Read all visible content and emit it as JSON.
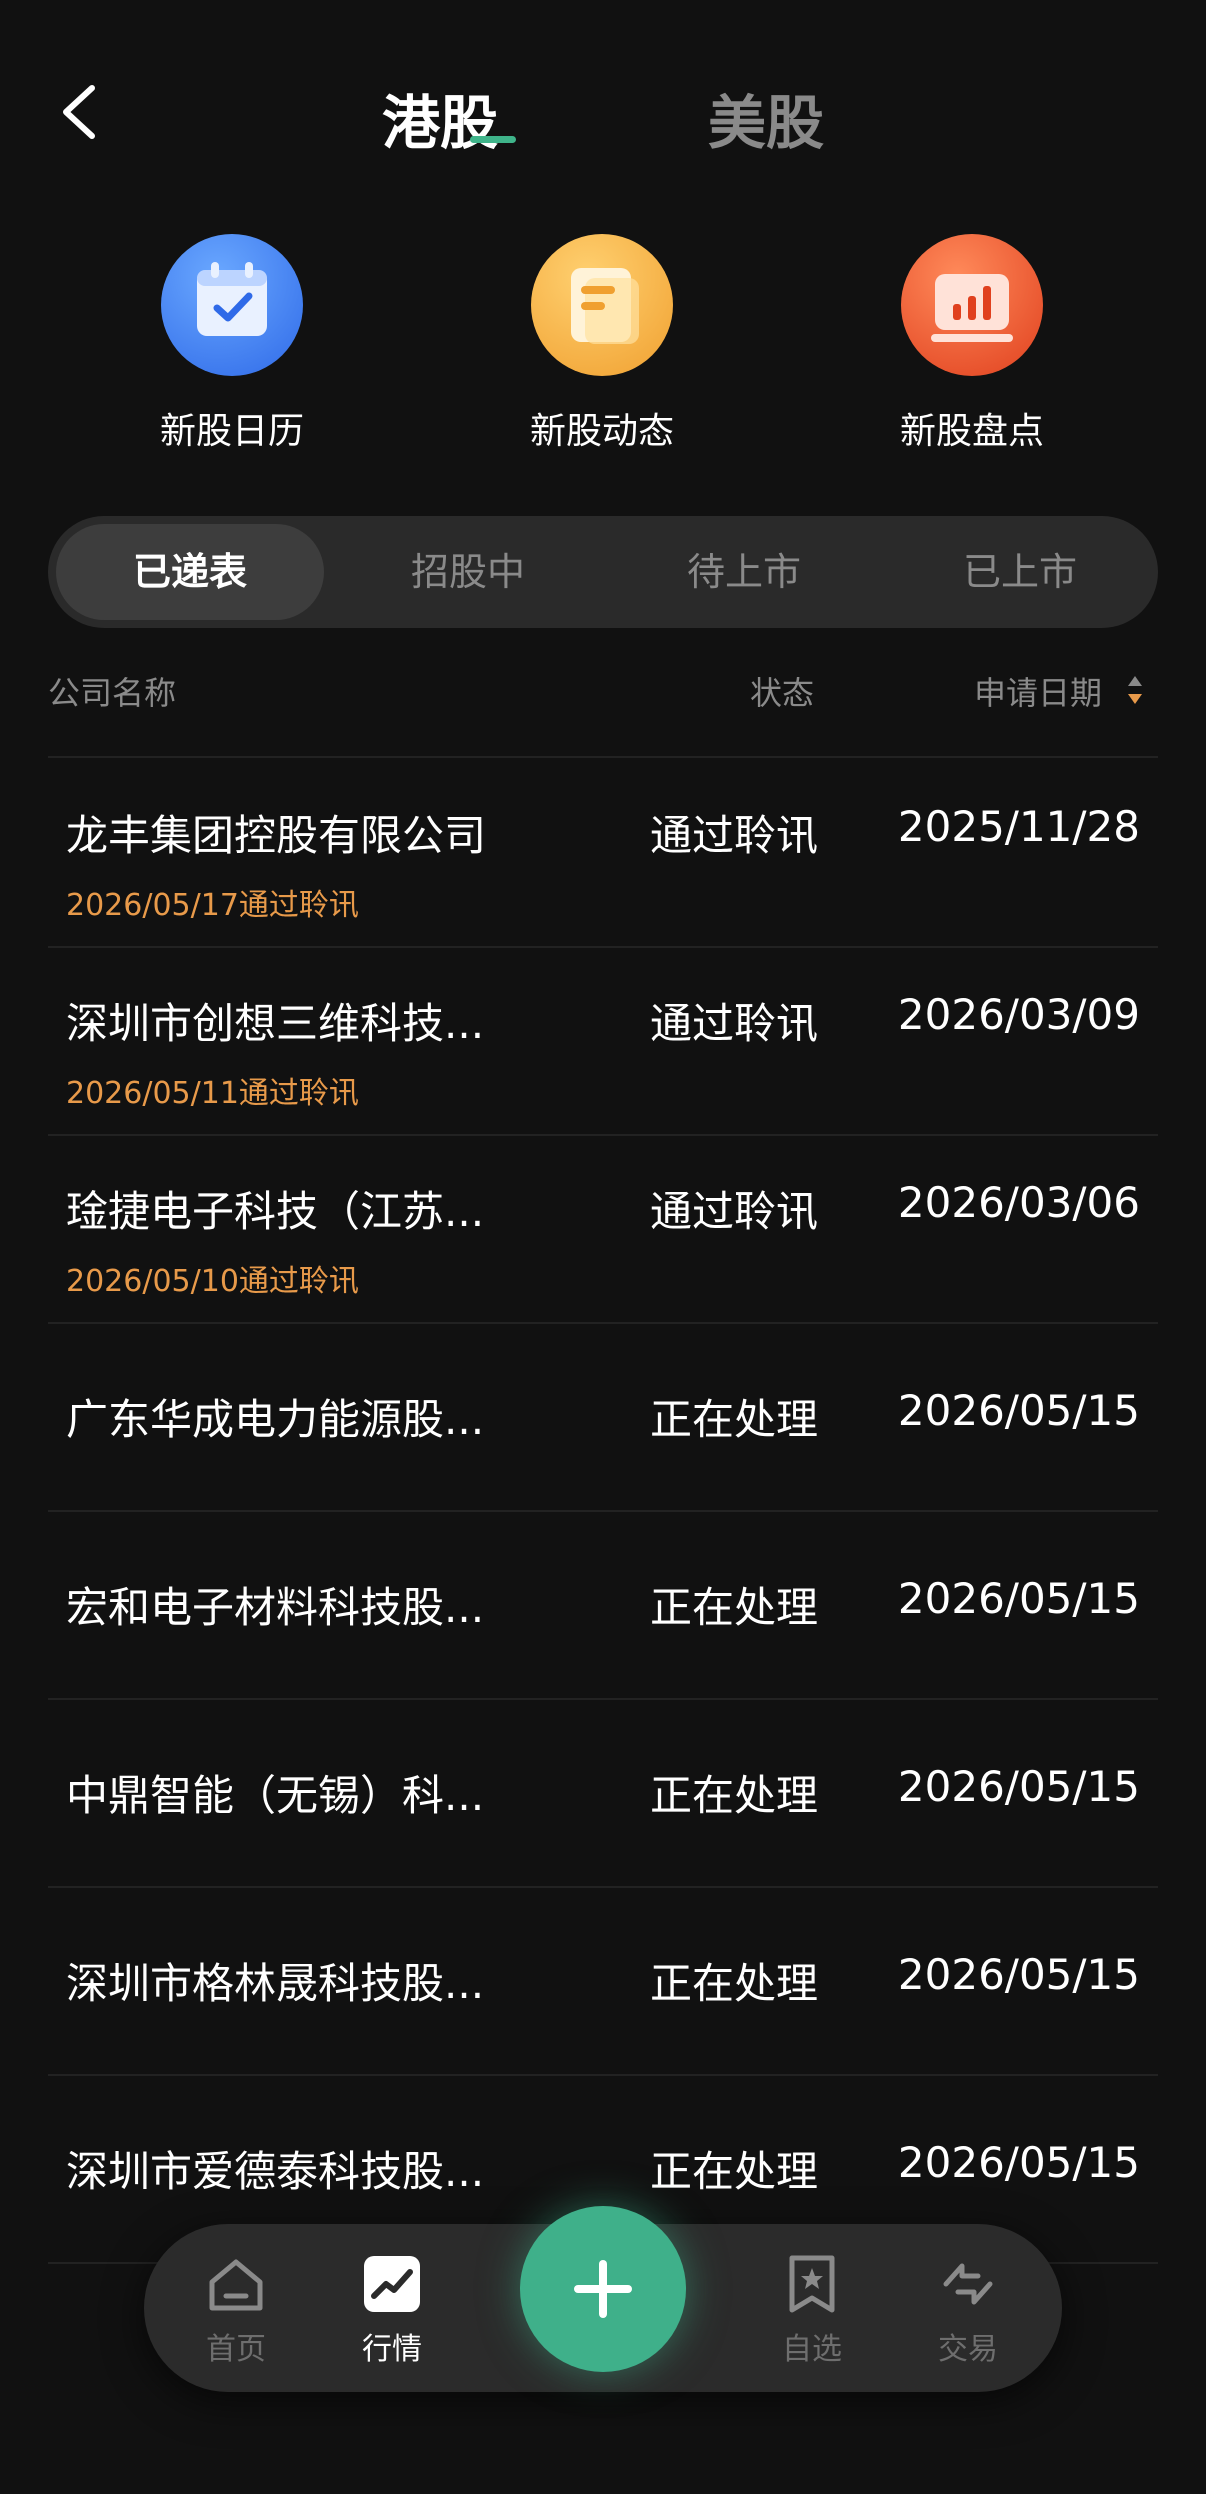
{
  "header": {
    "tabs": [
      {
        "label": "港股",
        "active": true
      },
      {
        "label": "美股",
        "active": false
      }
    ]
  },
  "shortcuts": [
    {
      "label": "新股日历",
      "icon": "calendar-check-icon",
      "color": "#3f7cf0"
    },
    {
      "label": "新股动态",
      "icon": "document-icon",
      "color": "#f0a030"
    },
    {
      "label": "新股盘点",
      "icon": "bar-chart-icon",
      "color": "#e5502a"
    }
  ],
  "segments": [
    "已递表",
    "招股中",
    "待上市",
    "已上市"
  ],
  "active_segment": "已递表",
  "columns": {
    "name": "公司名称",
    "status": "状态",
    "date": "申请日期"
  },
  "rows": [
    {
      "name": "龙丰集团控股有限公司",
      "status": "通过聆讯",
      "date": "2025/11/28",
      "sub": "2026/05/17通过聆讯"
    },
    {
      "name": "深圳市创想三维科技...",
      "status": "通过聆讯",
      "date": "2026/03/09",
      "sub": "2026/05/11通过聆讯"
    },
    {
      "name": "琻捷电子科技（江苏...",
      "status": "通过聆讯",
      "date": "2026/03/06",
      "sub": "2026/05/10通过聆讯"
    },
    {
      "name": "广东华成电力能源股...",
      "status": "正在处理",
      "date": "2026/05/15",
      "sub": ""
    },
    {
      "name": "宏和电子材料科技股...",
      "status": "正在处理",
      "date": "2026/05/15",
      "sub": ""
    },
    {
      "name": "中鼎智能（无锡）科...",
      "status": "正在处理",
      "date": "2026/05/15",
      "sub": ""
    },
    {
      "name": "深圳市格林晟科技股...",
      "status": "正在处理",
      "date": "2026/05/15",
      "sub": ""
    },
    {
      "name": "深圳市爱德泰科技股...",
      "status": "正在处理",
      "date": "2026/05/15",
      "sub": ""
    }
  ],
  "bottom_nav": [
    {
      "label": "首页",
      "icon": "home-icon",
      "active": false
    },
    {
      "label": "行情",
      "icon": "market-chart-icon",
      "active": true
    },
    {
      "label": "自选",
      "icon": "bookmark-star-icon",
      "active": false
    },
    {
      "label": "交易",
      "icon": "swap-arrows-icon",
      "active": false
    }
  ],
  "fab_icon": "plus-icon",
  "colors": {
    "accent": "#3fb08a",
    "highlight": "#e89a4a",
    "background": "#111111"
  }
}
